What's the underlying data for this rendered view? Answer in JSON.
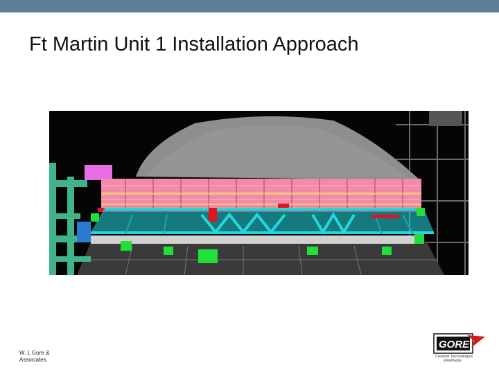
{
  "slide": {
    "title": "Ft Martin Unit 1 Installation Approach",
    "footer_line1": "W. L Gore &",
    "footer_line2": "Associates"
  },
  "logo": {
    "name": "GORE",
    "tagline_line1": "Creative Technologies",
    "tagline_line2": "Worldwide"
  },
  "image": {
    "subject": "installation-render"
  },
  "colors": {
    "top_bar": "#5b7e96",
    "hood": "#8e8e8e",
    "modules_pink": "#f28aa8",
    "frame_cyan": "#22d8e0",
    "support_green": "#22e03a",
    "accent_red": "#e0141e",
    "pipe_green": "#3fb48a",
    "magenta": "#e86ee6"
  }
}
